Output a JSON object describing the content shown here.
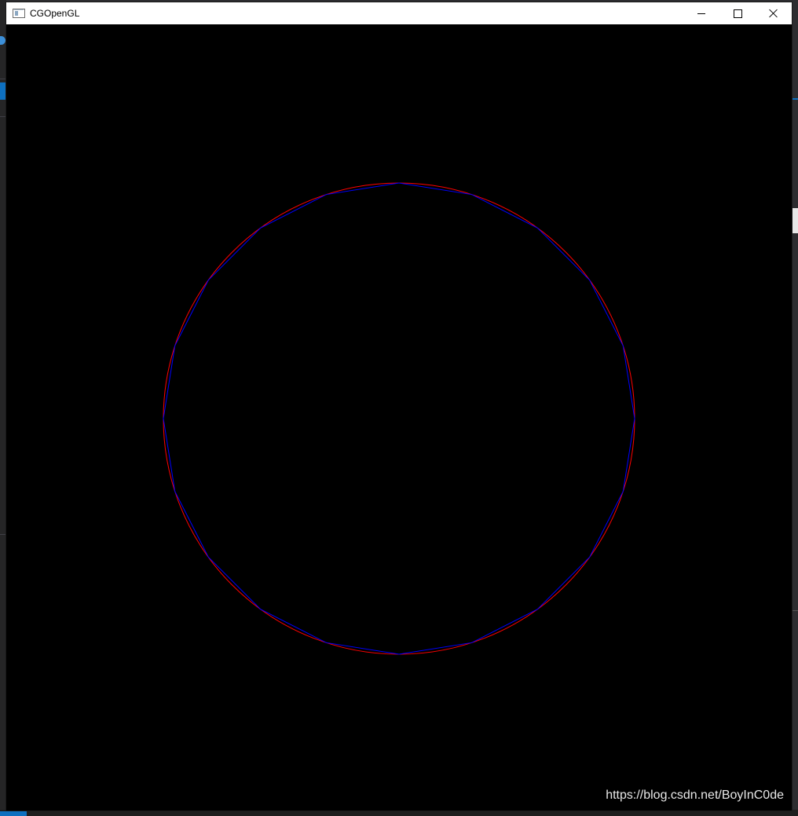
{
  "window": {
    "title": "CGOpenGL",
    "controls": {
      "minimize": "minimize",
      "maximize": "maximize",
      "close": "close"
    }
  },
  "canvas": {
    "background": "#000000",
    "shapes": [
      {
        "name": "rasterized-circle",
        "color": "#ff0000",
        "kind": "circle"
      },
      {
        "name": "polygon-approximation",
        "color": "#0000ff",
        "kind": "polygon",
        "sides": 20
      }
    ]
  },
  "watermark": {
    "text": "https://blog.csdn.net/BoyInC0de"
  }
}
